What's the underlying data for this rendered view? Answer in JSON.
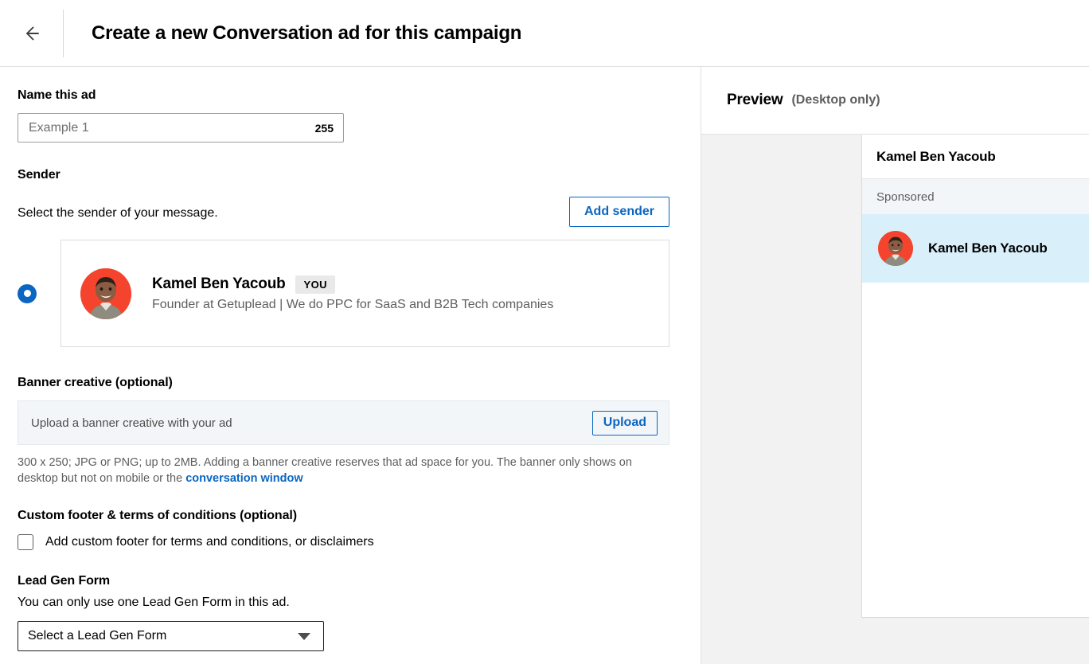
{
  "header": {
    "back_icon": "arrow-left-icon",
    "title": "Create a new Conversation ad for this campaign"
  },
  "form": {
    "name_section": {
      "label": "Name this ad",
      "input_value": "",
      "input_placeholder": "Example 1",
      "char_counter": "255"
    },
    "sender_section": {
      "label": "Sender",
      "help_text": "Select the sender of your message.",
      "add_sender_button": "Add sender",
      "selected_sender": {
        "name": "Kamel Ben Yacoub",
        "badge": "YOU",
        "headline": "Founder at Getuplead | We do PPC for SaaS and B2B Tech companies",
        "avatar_icon": "user-avatar-photo",
        "selected": true
      }
    },
    "banner_section": {
      "label": "Banner creative (optional)",
      "upload_strip_text": "Upload a banner creative with your ad",
      "upload_button": "Upload",
      "helper_text_before": "300 x 250; JPG or PNG; up to 2MB. Adding a banner creative reserves that ad space for you. The banner only shows on desktop but not on mobile or the ",
      "helper_link": "conversation window"
    },
    "footer_terms_section": {
      "label": "Custom footer & terms of conditions (optional)",
      "checkbox_label": "Add custom footer for terms and conditions, or disclaimers",
      "checkbox_checked": false
    },
    "lead_gen_section": {
      "label": "Lead Gen Form",
      "help_text": "You can only use one Lead Gen Form in this ad.",
      "select_value": "Select a Lead Gen Form",
      "caret_icon": "chevron-down-icon"
    }
  },
  "preview": {
    "title": "Preview",
    "subtitle": "(Desktop only)",
    "card": {
      "header_name": "Kamel Ben Yacoub",
      "sponsored_label": "Sponsored",
      "message_sender_name": "Kamel Ben Yacoub",
      "avatar_icon": "user-avatar-photo"
    }
  },
  "colors": {
    "accent_blue": "#0a66c2",
    "avatar_bg": "#f4442e",
    "message_highlight": "#d9f0fb",
    "strip_bg": "#f3f6f8",
    "stage_bg": "#f2f2f2"
  }
}
